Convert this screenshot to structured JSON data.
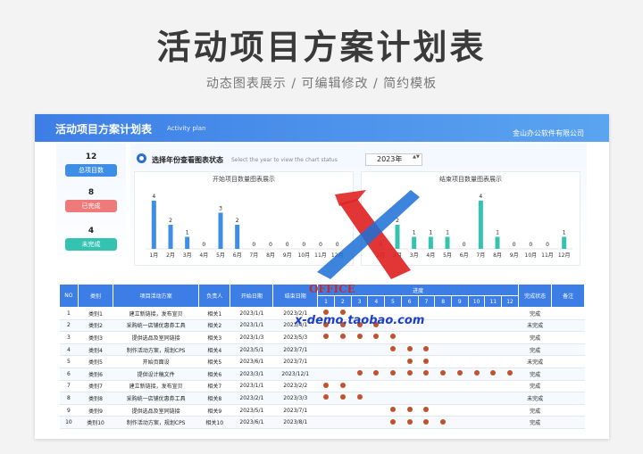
{
  "hero": {
    "title": "活动项目方案计划表",
    "subtitle": "动态图表展示 / 可编辑修改 / 简约模板"
  },
  "banner": {
    "title": "活动项目方案计划表",
    "title_en": "Activity plan",
    "company": "金山办公软件有限公司"
  },
  "stats": [
    {
      "value": "12",
      "label": "总项目数",
      "color": "#3d8ee6"
    },
    {
      "value": "8",
      "label": "已完成",
      "color": "#ee7a7a"
    },
    {
      "value": "4",
      "label": "未完成",
      "color": "#34c3b0"
    }
  ],
  "year_selector": {
    "label": "选择年份查看图表状态",
    "label_en": "Select the year to view the chart status",
    "value": "2023年",
    "spin": "▲▼"
  },
  "chart_data": [
    {
      "type": "bar",
      "title": "开始项目数量图表展示",
      "color": "#3d8ee6",
      "categories": [
        "1月",
        "2月",
        "3月",
        "4月",
        "5月",
        "6月",
        "7月",
        "8月",
        "9月",
        "10月",
        "11月",
        "12月"
      ],
      "values": [
        4,
        2,
        1,
        0,
        3,
        2,
        0,
        0,
        0,
        0,
        0,
        0
      ],
      "ylim": [
        0,
        4
      ]
    },
    {
      "type": "bar",
      "title": "结束项目数量图表展示",
      "color": "#34c3b0",
      "categories": [
        "1月",
        "2月",
        "3月",
        "4月",
        "5月",
        "6月",
        "7月",
        "8月",
        "9月",
        "10月",
        "11月",
        "12月"
      ],
      "values": [
        0,
        2,
        1,
        1,
        1,
        0,
        4,
        1,
        0,
        0,
        0,
        1
      ],
      "ylim": [
        0,
        4
      ]
    }
  ],
  "table": {
    "headers": {
      "no": "NO",
      "cat": "类别",
      "plan": "项目活动方案",
      "owner": "负责人",
      "start": "开始日期",
      "end": "结束日期",
      "progress": "进度",
      "status": "完成状态",
      "note": "备注"
    },
    "months": [
      "1",
      "2",
      "3",
      "4",
      "5",
      "6",
      "7",
      "8",
      "9",
      "10",
      "11",
      "12"
    ],
    "rows": [
      {
        "no": "1",
        "cat": "类别1",
        "plan": "建立新链接，发布宣贝",
        "owner": "相关1",
        "start": "2023/1/1",
        "end": "2023/2/1",
        "dots": [
          1,
          2
        ],
        "status": "完成"
      },
      {
        "no": "2",
        "cat": "类别2",
        "plan": "采购统一店铺优惠券工具",
        "owner": "相关2",
        "start": "2023/1/1",
        "end": "2023/4/1",
        "dots": [
          1,
          2,
          3,
          4
        ],
        "status": "未完成"
      },
      {
        "no": "3",
        "cat": "类别3",
        "plan": "提供选品及室同链接",
        "owner": "相关3",
        "start": "2023/1/3",
        "end": "2023/5/3",
        "dots": [
          1,
          2,
          3,
          4,
          5
        ],
        "status": "完成"
      },
      {
        "no": "4",
        "cat": "类别4",
        "plan": "制作活动方案，规划CPS",
        "owner": "相关4",
        "start": "2023/5/1",
        "end": "2023/7/1",
        "dots": [
          5,
          6,
          7
        ],
        "status": "完成"
      },
      {
        "no": "5",
        "cat": "类别5",
        "plan": "开始页面设",
        "owner": "相关5",
        "start": "2023/6/1",
        "end": "2023/7/1",
        "dots": [
          6,
          7
        ],
        "status": "未完成"
      },
      {
        "no": "6",
        "cat": "类别6",
        "plan": "提供设计稿文件",
        "owner": "相关6",
        "start": "2023/3/1",
        "end": "2023/12/1",
        "dots": [
          3,
          4,
          5,
          6,
          7,
          8,
          9,
          10,
          11,
          12
        ],
        "status": "完成"
      },
      {
        "no": "7",
        "cat": "类别7",
        "plan": "建立新链接，发布宣贝",
        "owner": "相关7",
        "start": "2023/1/1",
        "end": "2023/2/2",
        "dots": [
          1,
          2
        ],
        "status": "完成"
      },
      {
        "no": "8",
        "cat": "类别8",
        "plan": "采购统一店铺优惠券工具",
        "owner": "相关8",
        "start": "2023/2/1",
        "end": "2023/3/3",
        "dots": [
          1,
          2,
          3
        ],
        "status": "未完成"
      },
      {
        "no": "9",
        "cat": "类别9",
        "plan": "提供选品及室同链接",
        "owner": "相关9",
        "start": "2023/5/1",
        "end": "2023/7/1",
        "dots": [
          5,
          6,
          7
        ],
        "status": "完成"
      },
      {
        "no": "10",
        "cat": "类别10",
        "plan": "制作活动方案，规划CPS",
        "owner": "相关10",
        "start": "2023/6/1",
        "end": "2023/8/1",
        "dots": [
          5,
          6,
          7,
          8
        ],
        "status": "完成"
      }
    ]
  },
  "watermark": {
    "brand": "OFFICE",
    "url": "x-demo.taobao.com"
  }
}
